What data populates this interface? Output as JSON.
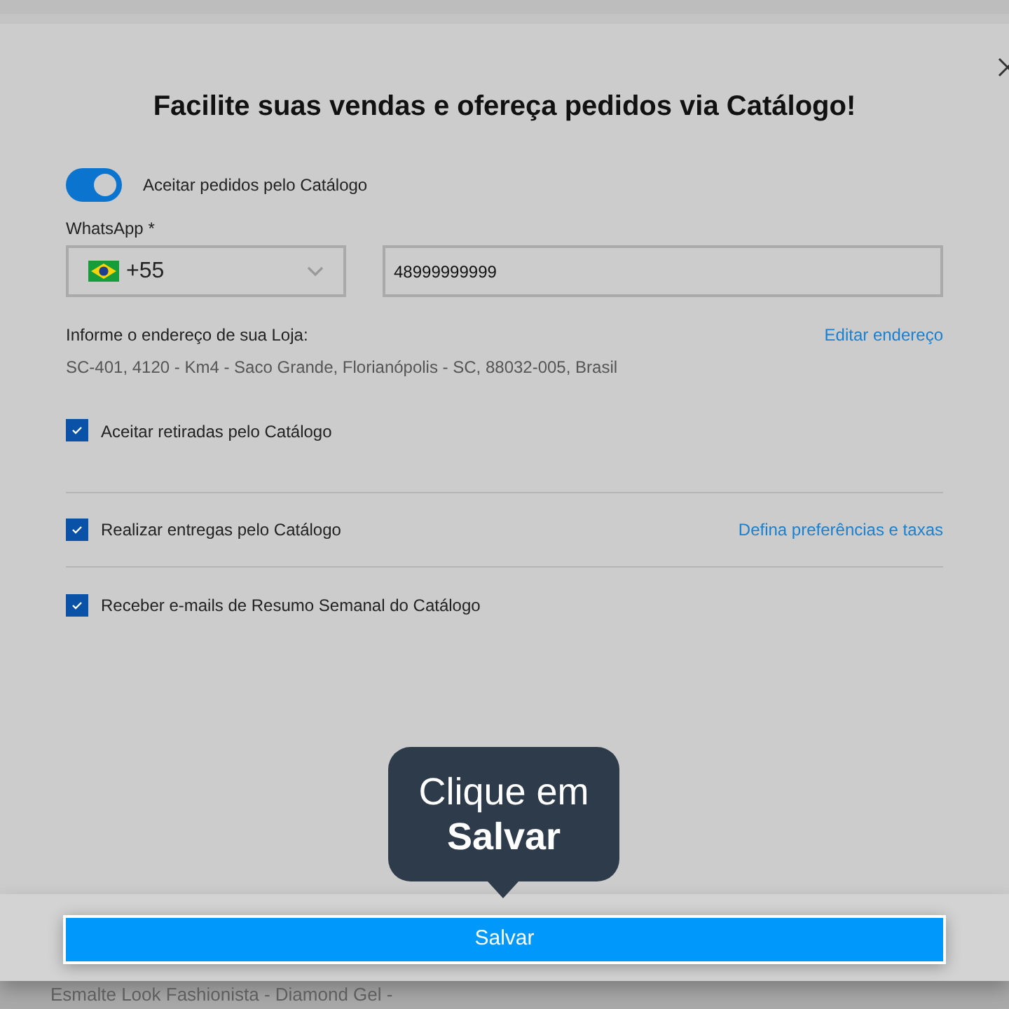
{
  "dialog": {
    "title": "Facilite suas vendas e ofereça pedidos via Catálogo!",
    "toggle": {
      "label": "Aceitar pedidos pelo Catálogo",
      "on": true
    },
    "whatsapp": {
      "label": "WhatsApp *",
      "country_code": "+55",
      "phone": "48999999999"
    },
    "address": {
      "label": "Informe o endereço de sua Loja:",
      "value": "SC-401, 4120 - Km4 - Saco Grande, Florianópolis - SC, 88032-005, Brasil",
      "link": "Editar endereço"
    },
    "options": [
      {
        "label": "Aceitar retiradas pelo Catálogo",
        "checked": true
      },
      {
        "label": "Realizar entregas pelo Catálogo",
        "checked": true,
        "link": "Defina preferências e taxas"
      },
      {
        "label": "Receber e-mails de Resumo Semanal do Catálogo",
        "checked": true
      }
    ],
    "save_button": "Salvar"
  },
  "tooltip": {
    "line_1": "Clique em",
    "line_2": "Salvar"
  },
  "background": {
    "text": "Esmalte Look Fashionista - Diamond Gel -"
  }
}
